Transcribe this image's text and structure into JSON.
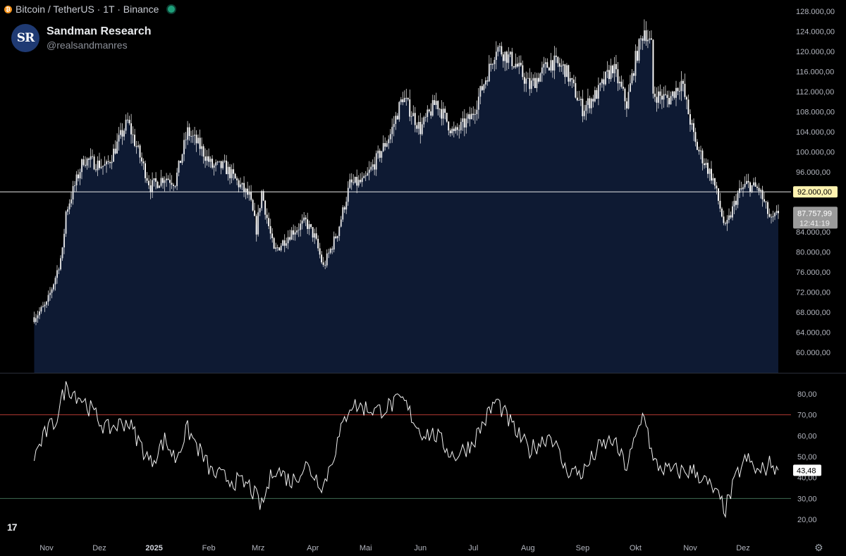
{
  "header": {
    "symbol_title": "Bitcoin / TetherUS · 1T · Binance",
    "brand_name": "Sandman Research",
    "brand_handle": "@realsandmanres",
    "avatar_initials": "SR",
    "logo_text": "17"
  },
  "colors": {
    "background": "#000000",
    "area_fill": "#0e1a33",
    "candles": "#e0e0e0",
    "level_line": "#e6e6e6",
    "level_label_bg": "#fff3b0",
    "price_label_bg": "#9b9b9b",
    "rsi_upper": "#b23a33",
    "rsi_lower": "#3f6b52",
    "rsi_line": "#f0f0f0"
  },
  "icons": {
    "asset": "bitcoin-icon",
    "status": "live-dot-icon",
    "footer_left": "tradingview-logo",
    "footer_right": "gear-icon"
  },
  "chart_data": [
    {
      "type": "line",
      "title": "Bitcoin / TetherUS · 1T · Binance",
      "style": "candlestick with area fill",
      "ylim": [
        56000,
        130000
      ],
      "y_ticks": [
        "128.000,00",
        "124.000,00",
        "120.000,00",
        "116.000,00",
        "112.000,00",
        "108.000,00",
        "104.000,00",
        "100.000,00",
        "96.000,00",
        "92.000,00",
        "88.000,00",
        "84.000,00",
        "80.000,00",
        "76.000,00",
        "72.000,00",
        "68.000,00",
        "64.000,00",
        "60.000,00"
      ],
      "x_labels": [
        "Nov",
        "Dez",
        "2025",
        "Feb",
        "Mrz",
        "Apr",
        "Mai",
        "Jun",
        "Jul",
        "Aug",
        "Sep",
        "Okt",
        "Nov",
        "Dez"
      ],
      "horizontal_level": {
        "value": 92000,
        "label": "92.000,00"
      },
      "last_price": {
        "value": 87757.99,
        "label": "87.757,99",
        "countdown": "12:41:19"
      },
      "series": [
        {
          "x": [
            "2024-10-25",
            "2024-11-01",
            "2024-11-06",
            "2024-11-10",
            "2024-11-12",
            "2024-11-22",
            "2024-12-05",
            "2024-12-17",
            "2024-12-30",
            "2025-01-07",
            "2025-01-13",
            "2025-01-20",
            "2025-01-27",
            "2025-02-03",
            "2025-02-10",
            "2025-02-24",
            "2025-02-28",
            "2025-03-03",
            "2025-03-10",
            "2025-03-20",
            "2025-03-28",
            "2025-04-02",
            "2025-04-07",
            "2025-04-15",
            "2025-04-22",
            "2025-04-30",
            "2025-05-08",
            "2025-05-15",
            "2025-05-22",
            "2025-06-01",
            "2025-06-10",
            "2025-06-20",
            "2025-06-30",
            "2025-07-11",
            "2025-07-14",
            "2025-07-25",
            "2025-08-02",
            "2025-08-14",
            "2025-08-22",
            "2025-09-01",
            "2025-09-10",
            "2025-09-18",
            "2025-09-26",
            "2025-10-01",
            "2025-10-06",
            "2025-10-10",
            "2025-10-11",
            "2025-10-20",
            "2025-10-27",
            "2025-11-04",
            "2025-11-14",
            "2025-11-21",
            "2025-11-28",
            "2025-12-03",
            "2025-12-10",
            "2025-12-17",
            "2025-12-21"
          ],
          "close": [
            67000,
            69500,
            75000,
            80000,
            88000,
            98500,
            97000,
            106000,
            93000,
            95000,
            94000,
            104000,
            101000,
            97000,
            97000,
            91000,
            84500,
            92000,
            80000,
            84000,
            86000,
            83000,
            77000,
            84000,
            93500,
            94000,
            99000,
            103500,
            111000,
            104500,
            110000,
            103500,
            107000,
            117500,
            121000,
            117500,
            113000,
            118000,
            116500,
            108500,
            112000,
            117000,
            109500,
            118500,
            124500,
            121000,
            111500,
            110500,
            114000,
            101500,
            94500,
            84500,
            91500,
            93500,
            92500,
            86000,
            87758
          ]
        }
      ]
    },
    {
      "type": "line",
      "title": "",
      "ylim": [
        15,
        87
      ],
      "y_ticks": [
        "80,00",
        "70,00",
        "60,00",
        "50,00",
        "40,00",
        "30,00",
        "20,00"
      ],
      "bands": [
        70,
        30
      ],
      "last_value": {
        "value": 43.48,
        "label": "43,48"
      },
      "series": [
        {
          "x": [
            "2024-10-25",
            "2024-11-01",
            "2024-11-06",
            "2024-11-12",
            "2024-11-22",
            "2024-12-05",
            "2024-12-17",
            "2024-12-30",
            "2025-01-07",
            "2025-01-13",
            "2025-01-20",
            "2025-02-03",
            "2025-02-24",
            "2025-03-03",
            "2025-03-10",
            "2025-03-20",
            "2025-03-28",
            "2025-04-07",
            "2025-04-22",
            "2025-05-08",
            "2025-05-22",
            "2025-06-01",
            "2025-06-10",
            "2025-06-20",
            "2025-06-30",
            "2025-07-14",
            "2025-07-25",
            "2025-08-02",
            "2025-08-14",
            "2025-08-22",
            "2025-09-01",
            "2025-09-10",
            "2025-09-18",
            "2025-09-26",
            "2025-10-06",
            "2025-10-11",
            "2025-10-20",
            "2025-11-04",
            "2025-11-14",
            "2025-11-21",
            "2025-11-28",
            "2025-12-03",
            "2025-12-10",
            "2025-12-17",
            "2025-12-21"
          ],
          "values": [
            50,
            62,
            67,
            84,
            77,
            63,
            67,
            47,
            58,
            49,
            63,
            42,
            36,
            26,
            45,
            38,
            46,
            36,
            75,
            72,
            77,
            62,
            60,
            50,
            56,
            77,
            62,
            53,
            61,
            44,
            42,
            54,
            58,
            45,
            72,
            47,
            43,
            43,
            34,
            25,
            42,
            49,
            42,
            47,
            43.48
          ]
        }
      ]
    }
  ]
}
